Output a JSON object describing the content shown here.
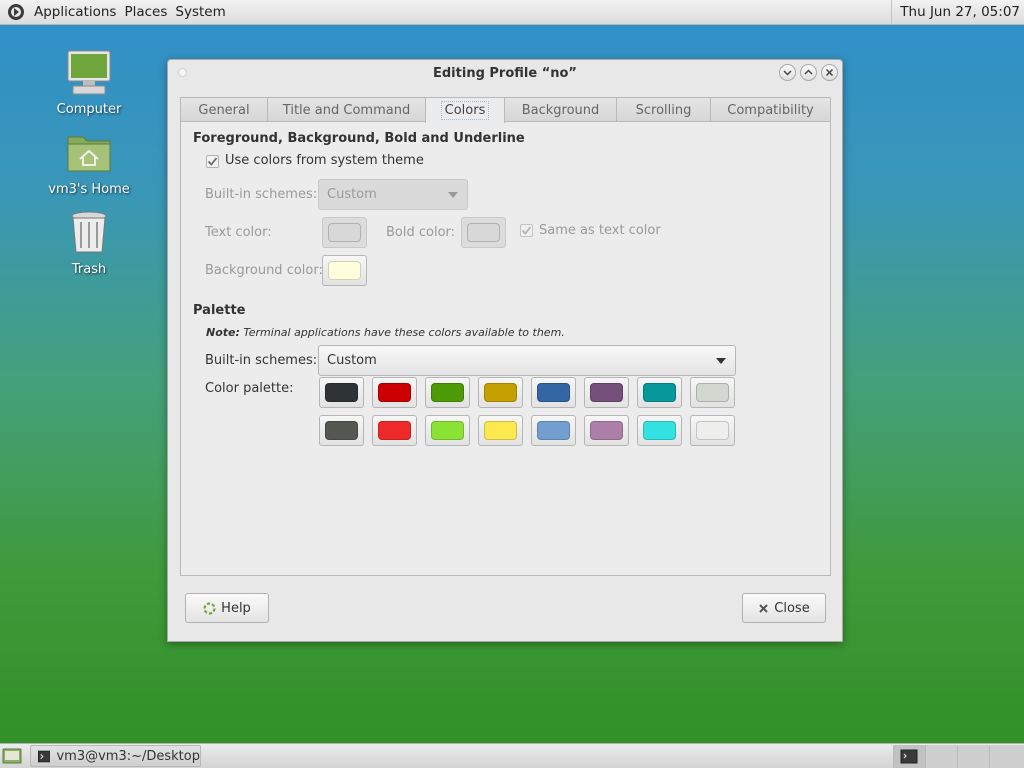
{
  "top_panel": {
    "menus": [
      "Applications",
      "Places",
      "System"
    ],
    "clock": "Thu Jun 27, 05:07"
  },
  "desktop": {
    "icons": [
      {
        "label": "Computer",
        "icon": "computer-icon"
      },
      {
        "label": "vm3's Home",
        "icon": "home-folder-icon"
      },
      {
        "label": "Trash",
        "icon": "trash-icon"
      }
    ]
  },
  "dialog": {
    "title": "Editing Profile “no”",
    "tabs": [
      "General",
      "Title and Command",
      "Colors",
      "Background",
      "Scrolling",
      "Compatibility"
    ],
    "active_tab": "Colors",
    "fg_section": {
      "title": "Foreground, Background, Bold and Underline",
      "use_system_colors_label": "Use colors from system theme",
      "use_system_colors_checked": true,
      "builtin_schemes_label": "Built-in schemes:",
      "builtin_schemes_value": "Custom",
      "text_color_label": "Text color:",
      "text_color": "#d8d8d8",
      "bold_color_label": "Bold color:",
      "bold_color": "#d8d8d8",
      "same_as_text_label": "Same as text color",
      "same_as_text_checked": true,
      "background_color_label": "Background color:",
      "background_color": "#ffffdd"
    },
    "palette_section": {
      "title": "Palette",
      "note_bold": "Note:",
      "note_text": "Terminal applications have these colors available to them.",
      "builtin_schemes_label": "Built-in schemes:",
      "builtin_schemes_value": "Custom",
      "color_palette_label": "Color palette:",
      "row1": [
        "#2e3436",
        "#cc0000",
        "#4e9a06",
        "#c4a000",
        "#3465a4",
        "#75507b",
        "#06989a",
        "#d3d7cf"
      ],
      "row2": [
        "#555753",
        "#ef2929",
        "#8ae234",
        "#fce94f",
        "#729fcf",
        "#ad7fa8",
        "#34e2e2",
        "#eeeeec"
      ]
    },
    "help_label": "Help",
    "close_label": "Close"
  },
  "bottom_panel": {
    "task_label": "vm3@vm3:~/Desktop"
  }
}
